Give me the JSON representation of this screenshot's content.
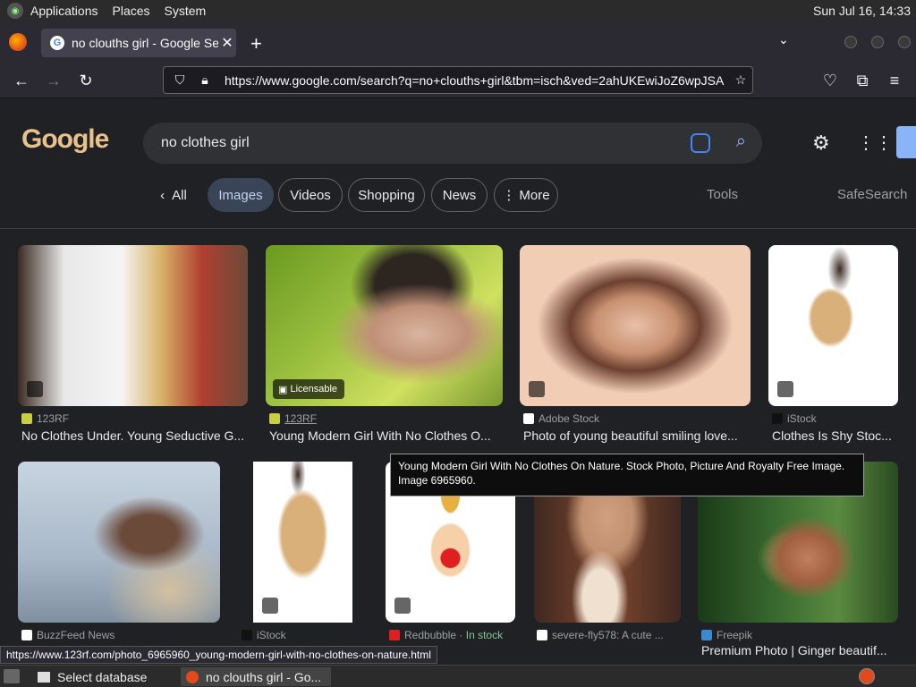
{
  "topbar": {
    "menus": [
      "Applications",
      "Places",
      "System"
    ],
    "clock": "Sun Jul 16, 14:33"
  },
  "browser": {
    "tab_title": "no clouths girl - Google Sear",
    "url": "https://www.google.com/search?q=no+clouths+girl&tbm=isch&ved=2ahUKEwiJoZ6wpJSA"
  },
  "google": {
    "query": "no clothes girl",
    "chips": [
      "All",
      "Images",
      "Videos",
      "Shopping",
      "News",
      "More"
    ],
    "tools": "Tools",
    "safesearch": "SafeSearch",
    "colors": {
      "accent": "#8ab4f8",
      "active_chip": "#394457",
      "in_stock": "#81c995"
    }
  },
  "results_row1": [
    {
      "source": "123RF",
      "caption": "No Clothes Under. Young Seductive G...",
      "colors": [
        "#d9b46a",
        "#6b5b4a",
        "#eeeeee"
      ]
    },
    {
      "source": "123RF",
      "caption": "Young Modern Girl With No Clothes O...",
      "badge": "Licensable",
      "colors": [
        "#9cc040",
        "#2d2520",
        "#d9b5a0"
      ]
    },
    {
      "source": "Adobe Stock",
      "caption": "Photo of young beautiful smiling love...",
      "colors": [
        "#f2cdb5",
        "#6b4030",
        "#e8c0a8"
      ]
    },
    {
      "source": "iStock",
      "caption": "Clothes Is Shy Stoc...",
      "colors": [
        "#ffffff",
        "#d9b07a",
        "#3a2a22"
      ]
    }
  ],
  "results_row2": [
    {
      "source": "BuzzFeed News",
      "caption": "",
      "colors": [
        "#a8b8c8",
        "#6b4a3a",
        "#d4c0a0"
      ]
    },
    {
      "source": "iStock",
      "caption": "",
      "colors": [
        "#ffffff",
        "#d9b07a",
        "#3a2a22"
      ]
    },
    {
      "source": "Redbubble",
      "stock": "In stock",
      "caption": "",
      "colors": [
        "#ffffff",
        "#e8b040",
        "#e02020"
      ]
    },
    {
      "source": "severe-fly578: A cute ...",
      "caption": "",
      "colors": [
        "#c09070",
        "#402820",
        "#f0e0d0"
      ]
    },
    {
      "source": "Freepik",
      "caption": "Premium Photo | Ginger beautif...",
      "colors": [
        "#3a6a30",
        "#c08060",
        "#8ab060"
      ]
    }
  ],
  "tooltip": "Young Modern Girl With No Clothes On Nature. Stock Photo, Picture And  Royalty Free Image. Image 6965960.",
  "status_url": "https://www.123rf.com/photo_6965960_young-modern-girl-with-no-clothes-on-nature.html",
  "taskbar": {
    "items": [
      "Select database",
      "no clouths girl - Go..."
    ]
  }
}
